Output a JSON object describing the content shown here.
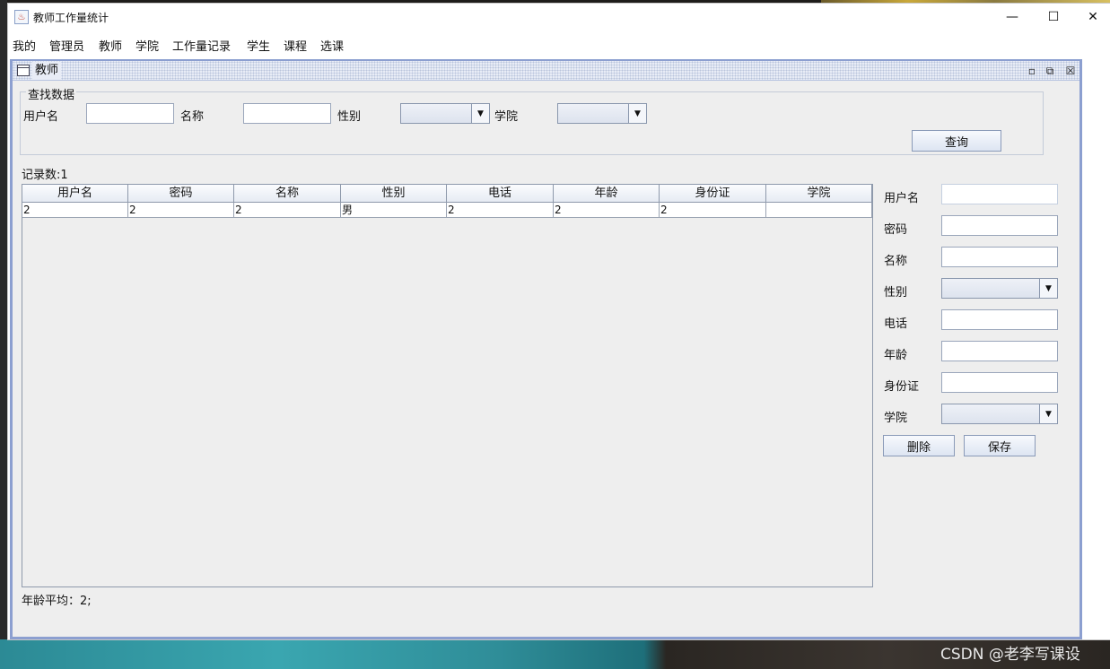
{
  "window": {
    "title": "教师工作量统计",
    "minimize_glyph": "—",
    "maximize_glyph": "☐",
    "close_glyph": "✕"
  },
  "menu": [
    "我的",
    "管理员",
    "教师",
    "学院",
    "工作量记录",
    "学生",
    "课程",
    "选课"
  ],
  "internal_frame": {
    "title": "教师",
    "ctrl_iconify": "▫",
    "ctrl_maximize": "⧉",
    "ctrl_close": "☒"
  },
  "search": {
    "legend": "查找数据",
    "username_label": "用户名",
    "name_label": "名称",
    "gender_label": "性别",
    "college_label": "学院",
    "username_value": "",
    "name_value": "",
    "gender_value": "",
    "college_value": "",
    "query_button": "查询"
  },
  "record_count": "记录数:1",
  "table": {
    "columns": [
      "用户名",
      "密码",
      "名称",
      "性别",
      "电话",
      "年龄",
      "身份证",
      "学院"
    ],
    "rows": [
      [
        "2",
        "2",
        "2",
        "男",
        "2",
        "2",
        "2",
        ""
      ]
    ]
  },
  "form": {
    "username_label": "用户名",
    "password_label": "密码",
    "name_label": "名称",
    "gender_label": "性别",
    "phone_label": "电话",
    "age_label": "年龄",
    "idcard_label": "身份证",
    "college_label": "学院",
    "username_value": "",
    "password_value": "",
    "name_value": "",
    "phone_value": "",
    "age_value": "",
    "idcard_value": "",
    "delete_button": "删除",
    "save_button": "保存"
  },
  "age_average": "年龄平均：2;",
  "watermark": "CSDN @老李写课设",
  "icons": {
    "dropdown": "chevron-down-icon",
    "app": "java-app-icon",
    "frame": "window-icon"
  },
  "colors": {
    "frame_border": "#8c9fd0",
    "panel_bg": "#eeeeee"
  }
}
